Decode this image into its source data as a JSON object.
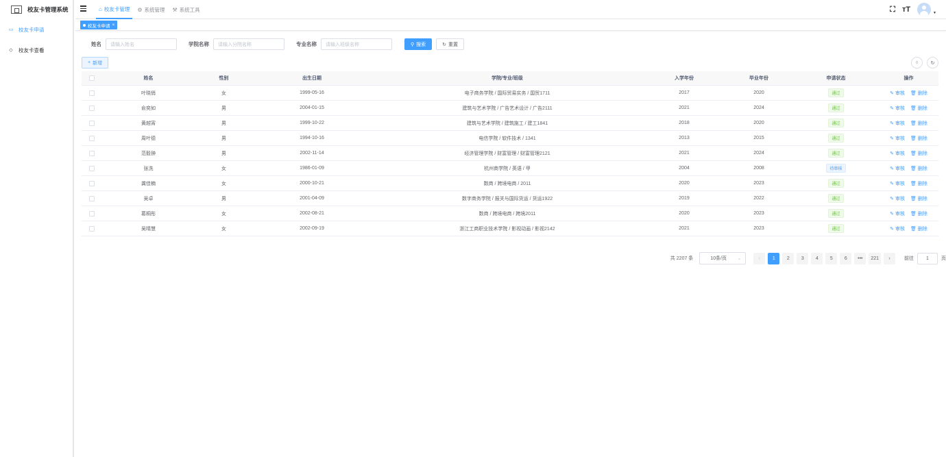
{
  "app": {
    "title": "校友卡管理系统"
  },
  "sidebar": {
    "items": [
      {
        "label": "校友卡申请",
        "icon": "card-icon",
        "active": true
      },
      {
        "label": "校友卡查看",
        "icon": "eye-icon",
        "active": false
      }
    ]
  },
  "topnav": {
    "items": [
      {
        "label": "校友卡管理",
        "icon": "home-icon",
        "active": true
      },
      {
        "label": "系统管理",
        "icon": "gear-icon",
        "active": false
      },
      {
        "label": "系统工具",
        "icon": "tool-icon",
        "active": false
      }
    ]
  },
  "tags": {
    "active_tag": "校友卡申请"
  },
  "search": {
    "name_label": "姓名",
    "name_placeholder": "请输入姓名",
    "college_label": "学院名称",
    "college_placeholder": "请输入分院名称",
    "major_label": "专业名称",
    "major_placeholder": "请输入班级名称",
    "search_btn": "搜索",
    "reset_btn": "重置"
  },
  "toolbar": {
    "add_btn": "新增"
  },
  "table": {
    "headers": {
      "name": "姓名",
      "sex": "性别",
      "birth": "出生日期",
      "school": "学院/专业/班级",
      "enroll": "入学年份",
      "grad": "毕业年份",
      "status": "申请状态",
      "op": "操作"
    },
    "ops": {
      "audit": "审核",
      "delete": "删除"
    },
    "rows": [
      {
        "name": "叶晓俏",
        "sex": "女",
        "birth": "1999-05-16",
        "school": "电子商务学院 / 国际贸易实务 / 国贸1711",
        "enroll": "2017",
        "grad": "2020",
        "status": "通过",
        "status_type": "ok"
      },
      {
        "name": "俞奕如",
        "sex": "男",
        "birth": "2004-01-15",
        "school": "建筑与艺术学院 / 广告艺术设计 / 广告2111",
        "enroll": "2021",
        "grad": "2024",
        "status": "通过",
        "status_type": "ok"
      },
      {
        "name": "黄越宵",
        "sex": "男",
        "birth": "1999-10-22",
        "school": "建筑与艺术学院 / 建筑施工 / 建工1841",
        "enroll": "2018",
        "grad": "2020",
        "status": "通过",
        "status_type": "ok"
      },
      {
        "name": "周叶德",
        "sex": "男",
        "birth": "1994-10-16",
        "school": "电信学院 / 软件技术 / 1341",
        "enroll": "2013",
        "grad": "2015",
        "status": "通过",
        "status_type": "ok"
      },
      {
        "name": "范毅翀",
        "sex": "男",
        "birth": "2002-11-14",
        "school": "经济管理学院 / 财富管理 / 财富管理2121",
        "enroll": "2021",
        "grad": "2024",
        "status": "通过",
        "status_type": "ok"
      },
      {
        "name": "张洗",
        "sex": "女",
        "birth": "1986-01-09",
        "school": "杭州商学院 / 英语 / 甲",
        "enroll": "2004",
        "grad": "2008",
        "status": "待审核",
        "status_type": "pending"
      },
      {
        "name": "龚佳楠",
        "sex": "女",
        "birth": "2000-10-21",
        "school": "数商 / 跨境电商 / 2011",
        "enroll": "2020",
        "grad": "2023",
        "status": "通过",
        "status_type": "ok"
      },
      {
        "name": "吴卓",
        "sex": "男",
        "birth": "2001-04-09",
        "school": "数字商务学院 / 报关与国际货运 / 货运1922",
        "enroll": "2019",
        "grad": "2022",
        "status": "通过",
        "status_type": "ok"
      },
      {
        "name": "葛桐彤",
        "sex": "女",
        "birth": "2002-08-21",
        "school": "数商 / 跨境电商 / 跨境2011",
        "enroll": "2020",
        "grad": "2023",
        "status": "通过",
        "status_type": "ok"
      },
      {
        "name": "吴晴慧",
        "sex": "女",
        "birth": "2002-09-19",
        "school": "浙江工商职业技术学院 / 影视动画 / 影视2142",
        "enroll": "2021",
        "grad": "2023",
        "status": "通过",
        "status_type": "ok"
      }
    ]
  },
  "pagination": {
    "total_text": "共 2207 条",
    "page_size": "10条/页",
    "pages": [
      "1",
      "2",
      "3",
      "4",
      "5",
      "6",
      "•••",
      "221"
    ],
    "current": "1",
    "goto_label": "前往",
    "goto_value": "1",
    "page_suffix": "页"
  },
  "colors": {
    "primary": "#409eff",
    "success": "#67c23a",
    "border": "#dcdfe6"
  }
}
